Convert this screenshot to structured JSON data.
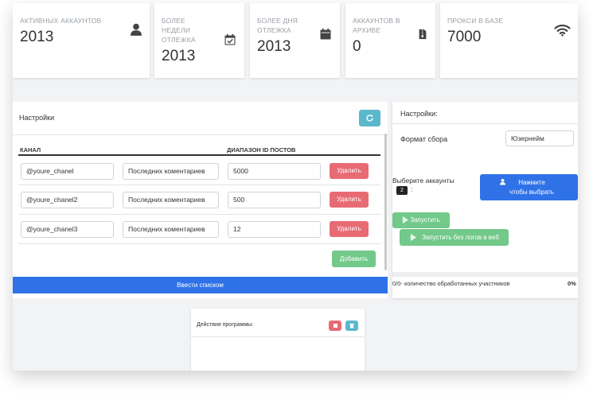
{
  "stats": [
    {
      "label": "АКТИВНЫХ АККАУНТОВ",
      "value": "2013",
      "icon": "user-icon"
    },
    {
      "label": "БОЛЕЕ НЕДЕЛИ ОТЛЕЖКА",
      "value": "2013",
      "icon": "calendar-check-icon"
    },
    {
      "label": "БОЛЕЕ ДНЯ ОТЛЕЖКА",
      "value": "2013",
      "icon": "calendar-icon"
    },
    {
      "label": "АККАУНТОВ В АРХИВЕ",
      "value": "0",
      "icon": "archive-file-icon"
    },
    {
      "label": "ПРОКСИ В БАЗЕ",
      "value": "7000",
      "icon": "wifi-icon"
    }
  ],
  "settings_left": {
    "title": "Настройки",
    "col_channel": "КАНАЛ",
    "col_range": "ДИАПАЗОН ID ПОСТОВ",
    "rows": [
      {
        "channel": "@youre_chanel",
        "mode": "Последних коментариев",
        "range": "5000",
        "delete": "Удалить"
      },
      {
        "channel": "@youre_chanel2",
        "mode": "Последних коментариев",
        "range": "500",
        "delete": "Удалить"
      },
      {
        "channel": "@youre_chanel3",
        "mode": "Последних коментариев",
        "range": "12",
        "delete": "Удалить"
      }
    ],
    "add_label": "Добавить",
    "list_label": "Ввести списком"
  },
  "settings_right": {
    "title": "Настройки:",
    "format_label": "Формат сбора",
    "format_value": "Юзернейм",
    "choose_label": "Выберите аккаунты",
    "choose_count": "2",
    "choose_colon": ":",
    "choose_button": "Нажмите чтобы выбрать",
    "run_label": "Запустить",
    "run_nolog_label": "Запустить без логов в веб",
    "progress_text": "0/0- количество обработанных участников",
    "progress_percent": "0%"
  },
  "actions": {
    "title": "Действия программы:"
  },
  "colors": {
    "danger": "#e86b74",
    "success": "#72c98a",
    "primary": "#2f72e8",
    "info": "#5bb8cc"
  }
}
